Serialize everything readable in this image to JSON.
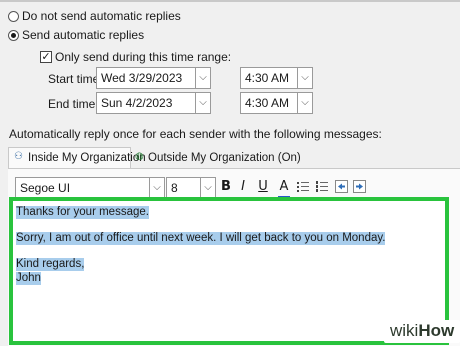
{
  "options": {
    "no_reply": "Do not send automatic replies",
    "send_reply": "Send automatic replies",
    "time_range": "Only send during this time range:"
  },
  "start": {
    "label": "Start time:",
    "date": "Wed 3/29/2023",
    "time": "4:30 AM"
  },
  "end": {
    "label": "End time:",
    "date": "Sun 4/2/2023",
    "time": "4:30 AM"
  },
  "instructions": "Automatically reply once for each sender with the following messages:",
  "tabs": [
    {
      "label": "Inside My Organization"
    },
    {
      "label": "Outside My Organization (On)"
    }
  ],
  "toolbar": {
    "font": "Segoe UI",
    "size": "8",
    "bold": "B",
    "italic": "I",
    "underline": "U",
    "font_color": "A"
  },
  "message": {
    "line1": "Thanks for your message.",
    "line2": "Sorry, I am out of office until next week. I will get back to you on Monday.",
    "line3": "Kind regards,",
    "line4": "John"
  },
  "watermark": {
    "prefix": "wiki",
    "suffix": "How"
  },
  "colors": {
    "highlight": "#a8cdec",
    "editor_border": "#29c33d"
  }
}
